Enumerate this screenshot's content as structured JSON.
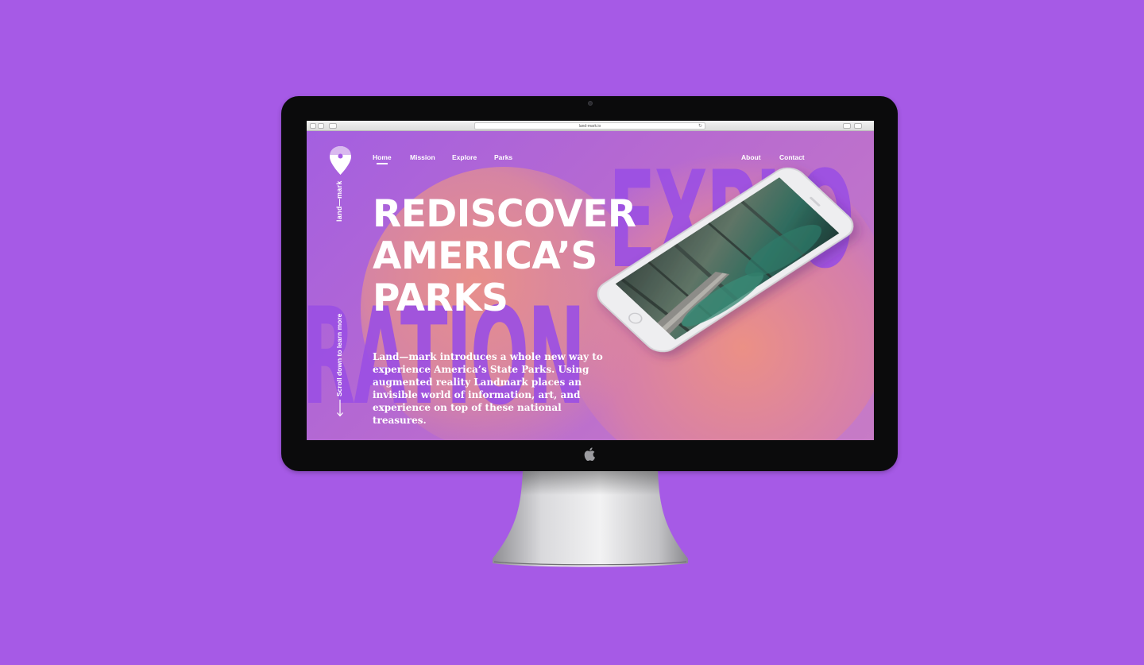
{
  "browser": {
    "url": "land-mark.io"
  },
  "site": {
    "brand": "land—mark",
    "nav_left": [
      "Home",
      "Mission",
      "Explore",
      "Parks"
    ],
    "nav_right": [
      "About",
      "Contact"
    ],
    "active_nav": "Home",
    "hero_lines": [
      "REDISCOVER",
      "AMERICA’S",
      "PARKS"
    ],
    "background_words": [
      "EXPLO",
      "RATION"
    ],
    "body": "Land—mark introduces a whole new way to experience America’s State Parks. Using augmented reality Landmark places an invisible world of information, art, and experience on top of these national treasures.",
    "scroll_hint": "Scroll down to learn more"
  },
  "colors": {
    "backdrop": "#a65ae6",
    "page_purple": "#a45fe0",
    "accent_orange": "#f1967e",
    "text": "#ffffff"
  },
  "icons": [
    "location-pin-icon",
    "back-icon",
    "forward-icon",
    "sidebar-icon",
    "reload-icon",
    "share-icon",
    "tabs-icon",
    "arrow-down-icon",
    "apple-logo-icon"
  ]
}
